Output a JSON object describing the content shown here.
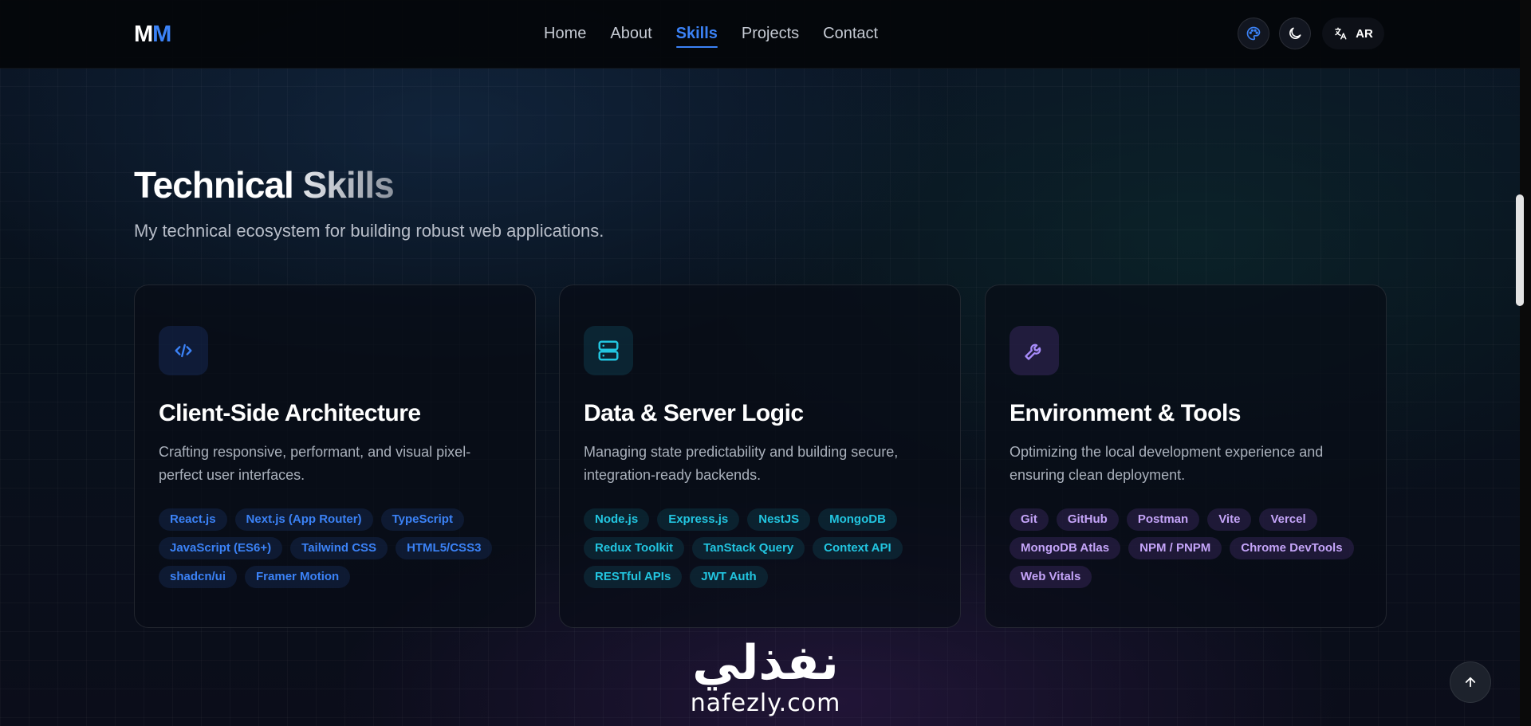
{
  "nav": {
    "logo": {
      "first": "M",
      "second": "M"
    },
    "links": [
      {
        "label": "Home",
        "active": false
      },
      {
        "label": "About",
        "active": false
      },
      {
        "label": "Skills",
        "active": true
      },
      {
        "label": "Projects",
        "active": false
      },
      {
        "label": "Contact",
        "active": false
      }
    ],
    "language_label": "AR",
    "icons": {
      "theme_palette": "palette-icon",
      "dark_mode": "moon-icon",
      "language": "translate-icon"
    }
  },
  "section": {
    "title_first": "Technical",
    "title_second": "Skills",
    "subtitle": "My technical ecosystem for building robust web applications."
  },
  "cards": [
    {
      "icon": "code-icon",
      "title": "Client-Side Architecture",
      "description": "Crafting responsive, performant, and visual pixel-perfect user interfaces.",
      "accent": "#3b82f6",
      "tags": [
        "React.js",
        "Next.js (App Router)",
        "TypeScript",
        "JavaScript (ES6+)",
        "Tailwind CSS",
        "HTML5/CSS3",
        "shadcn/ui",
        "Framer Motion"
      ]
    },
    {
      "icon": "server-icon",
      "title": "Data & Server Logic",
      "description": "Managing state predictability and building secure, integration-ready backends.",
      "accent": "#22c5e0",
      "tags": [
        "Node.js",
        "Express.js",
        "NestJS",
        "MongoDB",
        "Redux Toolkit",
        "TanStack Query",
        "Context API",
        "RESTful APIs",
        "JWT Auth"
      ]
    },
    {
      "icon": "wrench-icon",
      "title": "Environment & Tools",
      "description": "Optimizing the local development experience and ensuring clean deployment.",
      "accent": "#a78bfa",
      "tags": [
        "Git",
        "GitHub",
        "Postman",
        "Vite",
        "Vercel",
        "MongoDB Atlas",
        "NPM / PNPM",
        "Chrome DevTools",
        "Web Vitals"
      ]
    }
  ],
  "watermark": {
    "arabic": "نفذلي",
    "latin": "nafezly.com"
  },
  "scroll_top_icon": "arrow-up-icon"
}
